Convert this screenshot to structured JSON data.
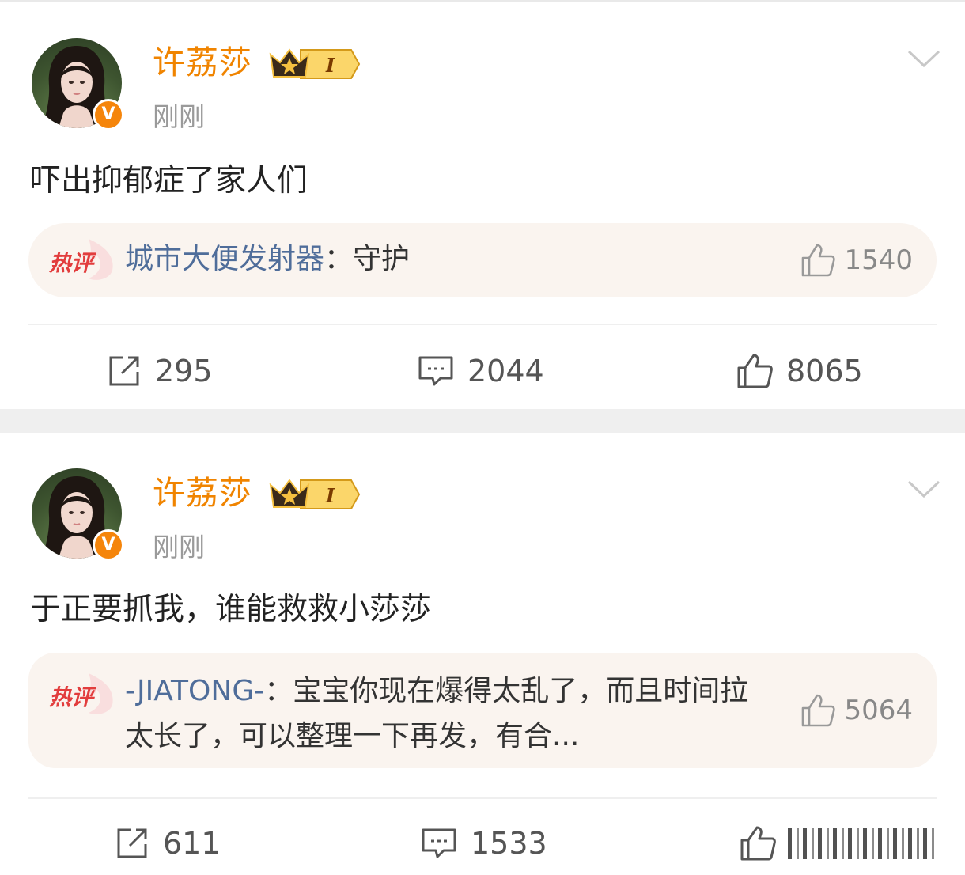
{
  "colors": {
    "username": "#f08400",
    "hot_user": "#4f6d9a",
    "hot_bg": "#faf4ef",
    "badge": "#f5850b"
  },
  "posts": [
    {
      "author": "许荔莎",
      "vip_level": "I",
      "time": "刚刚",
      "verified_badge": "V",
      "content": "吓出抑郁症了家人们",
      "hot_comment": {
        "tag": "热评",
        "user": "城市大便发射器",
        "sep": "：",
        "text": "守护",
        "likes": "1540"
      },
      "reposts": "295",
      "comments": "2044",
      "likes": "8065"
    },
    {
      "author": "许荔莎",
      "vip_level": "I",
      "time": "刚刚",
      "verified_badge": "V",
      "content": "于正要抓我，谁能救救小莎莎",
      "hot_comment": {
        "tag": "热评",
        "user": "-JIATONG-",
        "sep": "：",
        "text": "宝宝你现在爆得太乱了，而且时间拉太长了，可以整理一下再发，有合...",
        "likes": "5064"
      },
      "reposts": "611",
      "comments": "1533",
      "likes": ""
    }
  ]
}
